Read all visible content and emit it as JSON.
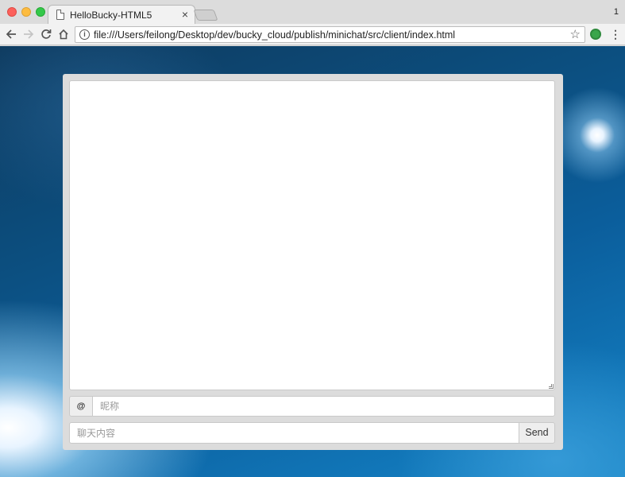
{
  "browser": {
    "tab_title": "HelloBucky-HTML5",
    "tab_close": "×",
    "profile_count": "1",
    "url": "file:///Users/feilong/Desktop/dev/bucky_cloud/publish/minichat/src/client/index.html",
    "icons": {
      "back": "arrow-left",
      "forward": "arrow-right",
      "reload": "reload",
      "home": "home",
      "info": "info",
      "star": "star",
      "extension": "green-extension",
      "menu": "kebab-menu"
    }
  },
  "chat": {
    "nickname_addon": "@",
    "nickname_placeholder": "昵称",
    "message_placeholder": "聊天内容",
    "send_label": "Send"
  },
  "colors": {
    "panel_bg": "#dcdcdc",
    "page_bg_dark": "#0c4f80",
    "page_bg_light": "#1a86c6"
  }
}
